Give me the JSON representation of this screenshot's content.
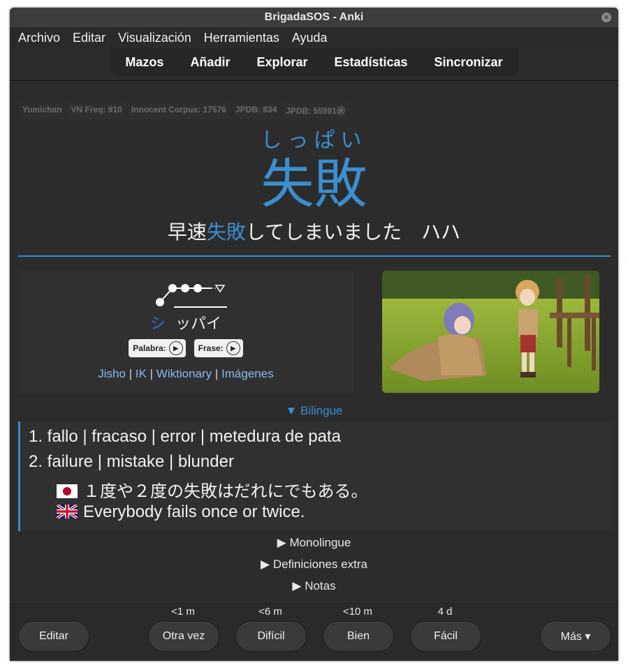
{
  "window": {
    "title": "BrigadaSOS - Anki",
    "close_glyph": "×"
  },
  "menu": [
    "Archivo",
    "Editar",
    "Visualización",
    "Herramientas",
    "Ayuda"
  ],
  "toolbar": [
    "Mazos",
    "Añadir",
    "Explorar",
    "Estadísticas",
    "Sincronizar"
  ],
  "tags": [
    "Yomichan",
    "VN Freq: 910",
    "Innocent Corpus: 17576",
    "JPDB: 834",
    "JPDB: 55991㊌"
  ],
  "card": {
    "reading": "しっぱい",
    "word": "失敗",
    "sentence_pre": "早速",
    "sentence_hl": "失敗",
    "sentence_post": "してしまいました　ハハ",
    "pitch_kana_1": "シ",
    "pitch_kana_2": "ッパイ",
    "audio_word": "Palabra:",
    "audio_sentence": "Frase:",
    "links": [
      "Jisho",
      "IK",
      "Wiktionary",
      "Imágenes"
    ],
    "link_sep": "|"
  },
  "sections": {
    "bilingue": "▼ Bilingue",
    "monolingue": "▶ Monolingue",
    "extra": "▶ Definiciones extra",
    "notas": "▶ Notas"
  },
  "definitions": {
    "line1": "1. fallo | fracaso | error | metedura de pata",
    "line2": "2. failure | mistake | blunder",
    "example_jp": "１度や２度の失敗はだれにでもある。",
    "example_en": "Everybody fails once or twice."
  },
  "answer": {
    "edit": "Editar",
    "buttons": [
      {
        "label": "Otra vez",
        "interval": "<1 m"
      },
      {
        "label": "Difícil",
        "interval": "<6 m"
      },
      {
        "label": "Bien",
        "interval": "<10 m"
      },
      {
        "label": "Fácil",
        "interval": "4 d"
      }
    ],
    "more": "Más ▾"
  },
  "colors": {
    "accent": "#3a8fd1",
    "bg": "#2c2c2c"
  }
}
